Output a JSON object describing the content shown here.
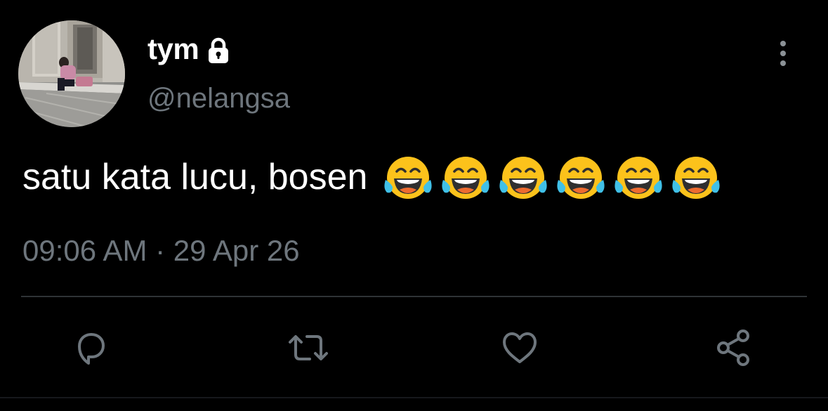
{
  "tweet": {
    "display_name": "tym",
    "handle": "@nelangsa",
    "text": "satu kata lucu, bosen",
    "emoji": [
      "😂",
      "😂",
      "😂",
      "😂",
      "😂",
      "😂"
    ],
    "timestamp": "09:06 AM · 29 Apr 26",
    "protected": true
  },
  "icons": {
    "lock": "lock-icon",
    "more": "more-vertical-icon",
    "reply": "reply-icon",
    "retweet": "retweet-icon",
    "like": "heart-icon",
    "share": "share-icon"
  },
  "colors": {
    "background": "#000000",
    "text": "#ffffff",
    "secondary": "#6e767d",
    "divider": "#2f3336",
    "icon": "#6e767d"
  }
}
